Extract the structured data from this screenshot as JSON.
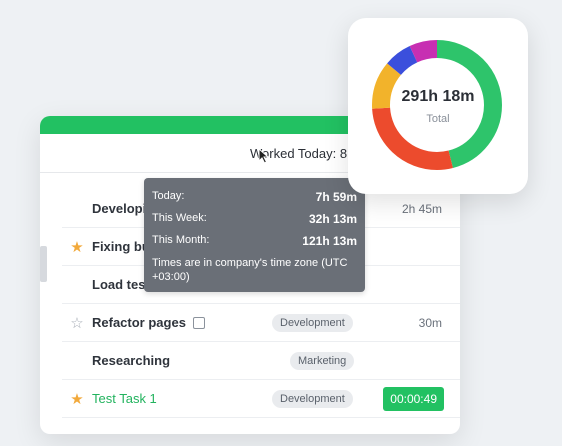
{
  "worked_today_label": "Worked Today: 8",
  "tasks": [
    {
      "star": "",
      "name": "Developi",
      "tag": "",
      "time": "2h 45m"
    },
    {
      "star": "★",
      "name": "Fixing bu",
      "tag": "",
      "time": ""
    },
    {
      "star": "",
      "name": "Load tes",
      "tag": "",
      "time": ""
    },
    {
      "star": "☆",
      "name": "Refactor pages",
      "tag": "Development",
      "time": "30m"
    },
    {
      "star": "",
      "name": "Researching",
      "tag": "Marketing",
      "time": ""
    },
    {
      "star": "★",
      "name": "Test Task 1",
      "tag": "Development",
      "timer": "00:00:49"
    }
  ],
  "tooltip": {
    "today_label": "Today:",
    "today_value": "7h  59m",
    "week_label": "This Week:",
    "week_value": "32h 13m",
    "month_label": "This Month:",
    "month_value": "121h 13m",
    "note": "Times are in company's time zone (UTC +03:00)"
  },
  "donut": {
    "total": "291h 18m",
    "label": "Total",
    "segments": [
      {
        "color": "#2ec46b",
        "fraction": 0.46
      },
      {
        "color": "#ec4b2d",
        "fraction": 0.28
      },
      {
        "color": "#f2b32b",
        "fraction": 0.12
      },
      {
        "color": "#3b4fdc",
        "fraction": 0.07
      },
      {
        "color": "#c72fb2",
        "fraction": 0.07
      }
    ]
  },
  "colors": {
    "accent": "#22c162",
    "star": "#f2a93b",
    "tooltip_bg": "#6a6f77"
  }
}
